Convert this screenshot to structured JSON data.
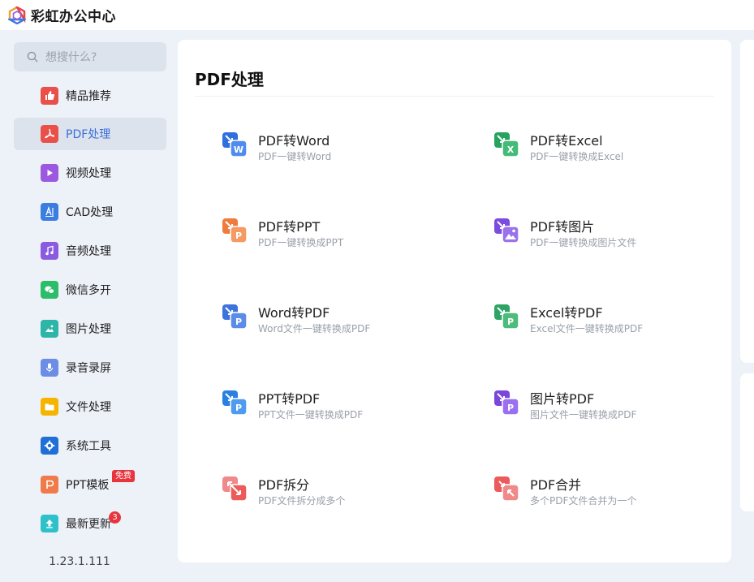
{
  "app": {
    "title": "彩虹办公中心"
  },
  "search": {
    "placeholder": "想搜什么?"
  },
  "sidebar": {
    "items": [
      {
        "label": "精品推荐",
        "icon": "thumbs-up-icon",
        "color": "#e9504a"
      },
      {
        "label": "PDF处理",
        "icon": "pdf-icon",
        "color": "#e9504a",
        "active": true
      },
      {
        "label": "视频处理",
        "icon": "play-icon",
        "color": "#9b59e0"
      },
      {
        "label": "CAD处理",
        "icon": "cad-icon",
        "color": "#3b7de0"
      },
      {
        "label": "音频处理",
        "icon": "music-icon",
        "color": "#8a5be0"
      },
      {
        "label": "微信多开",
        "icon": "wechat-icon",
        "color": "#2bbd6a"
      },
      {
        "label": "图片处理",
        "icon": "image-icon",
        "color": "#2db5a8"
      },
      {
        "label": "录音录屏",
        "icon": "microphone-icon",
        "color": "#6b8de6"
      },
      {
        "label": "文件处理",
        "icon": "folder-icon",
        "color": "#f5b400"
      },
      {
        "label": "系统工具",
        "icon": "gear-icon",
        "color": "#1f6fd6"
      },
      {
        "label": "PPT模板",
        "icon": "ppt-icon",
        "color": "#f07a4a",
        "badge": "免费"
      },
      {
        "label": "最新更新",
        "icon": "upload-icon",
        "color": "#2fc1c9",
        "count": "3"
      }
    ],
    "version": "1.23.1.111"
  },
  "main": {
    "title": "PDF处理",
    "tools": [
      {
        "name": "PDF转Word",
        "desc": "PDF一键转Word",
        "icon": "pdf-to-word-icon",
        "color": "#2f6fe0",
        "letter": "W"
      },
      {
        "name": "PDF转Excel",
        "desc": "PDF一键转换成Excel",
        "icon": "pdf-to-excel-icon",
        "color": "#27a35f",
        "letter": "X"
      },
      {
        "name": "PDF转PPT",
        "desc": "PDF一键转换成PPT",
        "icon": "pdf-to-ppt-icon",
        "color": "#ef7b3c",
        "letter": "P"
      },
      {
        "name": "PDF转图片",
        "desc": "PDF一键转换成图片文件",
        "icon": "pdf-to-image-icon",
        "color": "#7b4ddf",
        "letter": "img"
      },
      {
        "name": "Word转PDF",
        "desc": "Word文件一键转换成PDF",
        "icon": "word-to-pdf-icon",
        "color": "#3d73dc",
        "letter": "P"
      },
      {
        "name": "Excel转PDF",
        "desc": "Excel文件一键转换成PDF",
        "icon": "excel-to-pdf-icon",
        "color": "#2ea464",
        "letter": "P"
      },
      {
        "name": "PPT转PDF",
        "desc": "PPT文件一键转换成PDF",
        "icon": "ppt-to-pdf-icon",
        "color": "#2a7fe0",
        "letter": "P"
      },
      {
        "name": "图片转PDF",
        "desc": "图片文件一键转换成PDF",
        "icon": "image-to-pdf-icon",
        "color": "#7a47dc",
        "letter": "P"
      },
      {
        "name": "PDF拆分",
        "desc": "PDF文件拆分成多个",
        "icon": "pdf-split-icon",
        "color": "#ec5a5a",
        "letter": "split"
      },
      {
        "name": "PDF合并",
        "desc": "多个PDF文件合并为一个",
        "icon": "pdf-merge-icon",
        "color": "#ec5a5a",
        "letter": "merge"
      }
    ]
  }
}
